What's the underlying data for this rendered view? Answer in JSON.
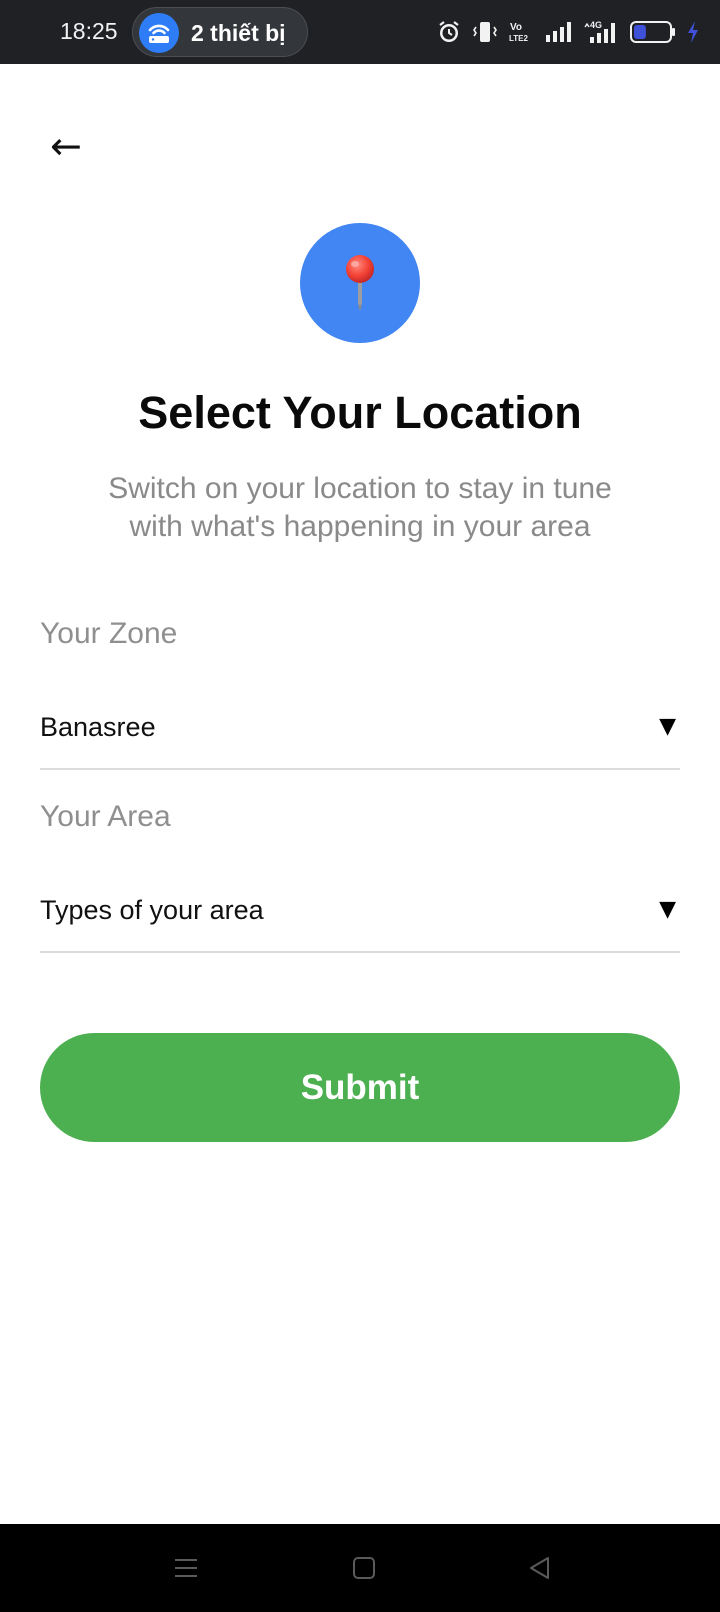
{
  "status_bar": {
    "time": "18:25",
    "hotspot_label": "2 thiết bị",
    "network": "4G",
    "volte": "Vo LTE2",
    "battery_level": 0.35,
    "icons": [
      "alarm-icon",
      "vibrate-icon",
      "volte-icon",
      "signal-icon",
      "4g-signal-icon",
      "battery-icon",
      "charging-icon"
    ]
  },
  "header": {
    "back_icon": "←"
  },
  "hero": {
    "icon": "map-pin-icon",
    "circle_color": "#4286f4",
    "title": "Select Your Location",
    "subtitle": "Switch on your location to stay in tune with what's happening in your area"
  },
  "form": {
    "zone": {
      "label": "Your Zone",
      "value": "Banasree",
      "caret": "▼"
    },
    "area": {
      "label": "Your Area",
      "value": "Types of your area",
      "caret": "▼"
    },
    "submit_label": "Submit",
    "submit_color": "#4caf50"
  },
  "nav_bar": {
    "buttons": [
      "menu-icon",
      "home-icon",
      "back-triangle-icon"
    ]
  }
}
